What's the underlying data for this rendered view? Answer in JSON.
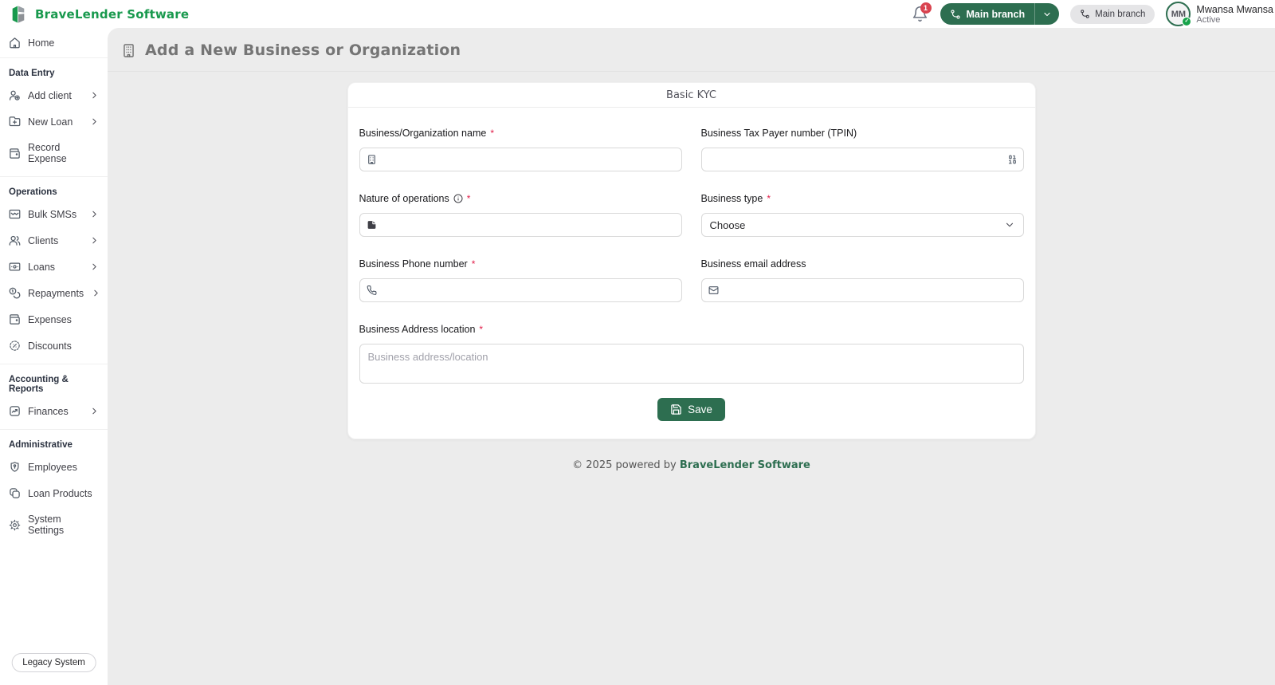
{
  "header": {
    "brand": "BraveLender Software",
    "notifications": {
      "count": "1"
    },
    "branch_button": {
      "label": "Main branch"
    },
    "branch_pill": {
      "label": "Main branch"
    },
    "user": {
      "initials": "MM",
      "name": "Mwansa Mwansa",
      "status": "Active"
    }
  },
  "sidebar": {
    "home_label": "Home",
    "sections": [
      {
        "title": "Data Entry",
        "items": [
          {
            "label": "Add client"
          },
          {
            "label": "New Loan"
          },
          {
            "label": "Record Expense"
          }
        ]
      },
      {
        "title": "Operations",
        "items": [
          {
            "label": "Bulk SMSs"
          },
          {
            "label": "Clients"
          },
          {
            "label": "Loans"
          },
          {
            "label": "Repayments"
          },
          {
            "label": "Expenses"
          },
          {
            "label": "Discounts"
          }
        ]
      },
      {
        "title": "Accounting & Reports",
        "items": [
          {
            "label": "Finances"
          }
        ]
      },
      {
        "title": "Administrative",
        "items": [
          {
            "label": "Employees"
          },
          {
            "label": "Loan Products"
          },
          {
            "label": "System Settings"
          }
        ]
      }
    ],
    "legacy_button_label": "Legacy System"
  },
  "page": {
    "title": "Add a New Business or Organization"
  },
  "form": {
    "card_title": "Basic KYC",
    "required_marker": "*",
    "business_name": {
      "label": "Business/Organization name",
      "value": ""
    },
    "tpin": {
      "label": "Business Tax Payer number (TPIN)",
      "value": ""
    },
    "nature": {
      "label": "Nature of operations",
      "value": ""
    },
    "business_type": {
      "label": "Business type",
      "value": "Choose"
    },
    "phone": {
      "label": "Business Phone number",
      "value": ""
    },
    "email": {
      "label": "Business email address",
      "value": ""
    },
    "address": {
      "label": "Business Address location",
      "placeholder": "Business address/location",
      "value": ""
    },
    "save_label": "Save"
  },
  "footer": {
    "text": "© 2025 powered by",
    "brand": "BraveLender Software"
  },
  "colors": {
    "brand_green": "#18994d",
    "button_green": "#2d6e50",
    "badge_red": "#d9434f",
    "page_bg": "#ececec"
  }
}
